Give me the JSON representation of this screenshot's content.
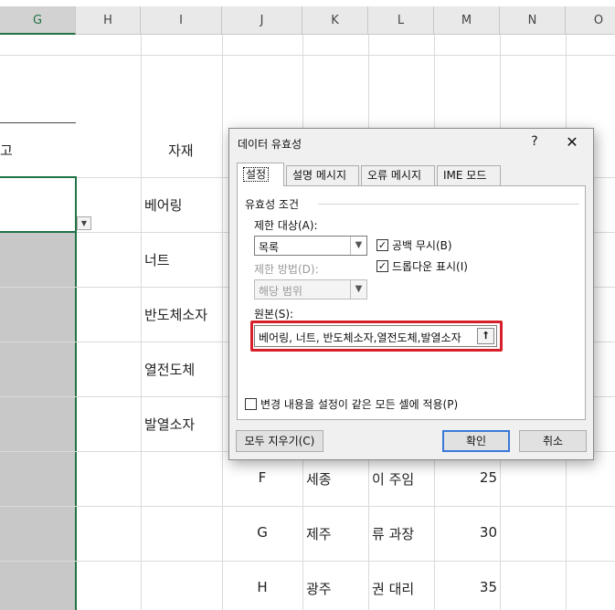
{
  "spreadsheet": {
    "columns": [
      "G",
      "H",
      "I",
      "J",
      "K",
      "L",
      "M",
      "N",
      "O"
    ],
    "header_cell_partial": "고",
    "material_header": "자재",
    "materials": [
      "베어링",
      "너트",
      "반도체소자",
      "열전도체",
      "발열소자"
    ],
    "rows": [
      {
        "code": "F",
        "city": "세종",
        "person": "이 주임",
        "value": "25"
      },
      {
        "code": "G",
        "city": "제주",
        "person": "류 과장",
        "value": "30"
      },
      {
        "code": "H",
        "city": "광주",
        "person": "권 대리",
        "value": "35"
      }
    ],
    "colors": {
      "selection_border": "#217346",
      "gray_fill": "#c8c8c8"
    }
  },
  "dialog": {
    "title": "데이터 유효성",
    "help_glyph": "?",
    "close_glyph": "✕",
    "tabs": [
      {
        "label": "설정",
        "active": true
      },
      {
        "label": "설명 메시지",
        "active": false
      },
      {
        "label": "오류 메시지",
        "active": false
      },
      {
        "label": "IME 모드",
        "active": false
      }
    ],
    "group_title": "유효성 조건",
    "allow_label": "제한 대상(A):",
    "allow_value": "목록",
    "data_label": "제한 방법(D):",
    "data_value": "해당 범위",
    "ignore_blank_label": "공백 무시(B)",
    "ignore_blank_checked": true,
    "in_cell_dropdown_label": "드롭다운 표시(I)",
    "in_cell_dropdown_checked": true,
    "source_label": "원본(S):",
    "source_value": "베어링, 너트, 반도체소자,열전도체,발열소자",
    "apply_all_label": "변경 내용을 설정이 같은 모든 셀에 적용(P)",
    "apply_all_checked": false,
    "clear_all_button": "모두 지우기(C)",
    "ok_button": "확인",
    "cancel_button": "취소",
    "highlight_color": "#d61f2a"
  }
}
